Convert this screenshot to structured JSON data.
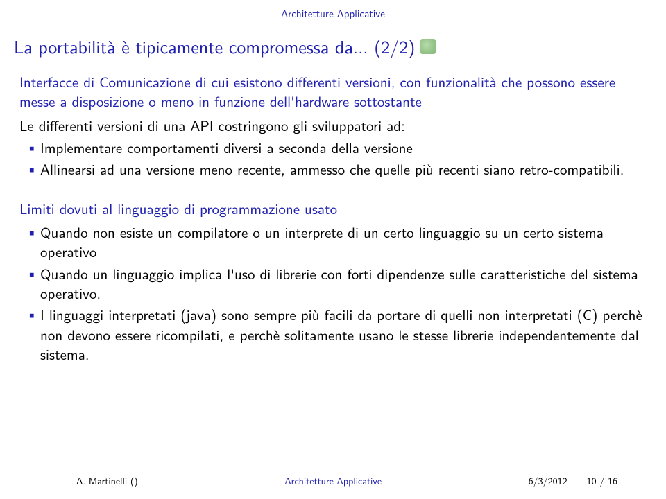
{
  "header": {
    "section": "Architetture Applicative"
  },
  "title": "La portabilità è tipicamente compromessa da... (2/2)",
  "block1": {
    "heading": "Interfacce di Comunicazione di cui esistono differenti versioni, con funzionalità che possono essere messe a disposizione o meno in funzione dell'hardware sottostante",
    "intro": "Le differenti versioni di una API costringono gli sviluppatori ad:",
    "items": [
      "Implementare comportamenti diversi a seconda della versione",
      "Allinearsi ad una versione meno recente, ammesso che quelle più recenti siano retro-compatibili."
    ]
  },
  "block2": {
    "heading": "Limiti dovuti al linguaggio di programmazione usato",
    "items": [
      "Quando non esiste un compilatore o un interprete di un certo linguaggio su un certo sistema operativo",
      "Quando un linguaggio implica l'uso di librerie con forti dipendenze sulle caratteristiche del sistema operativo.",
      "I linguaggi interpretati (java) sono sempre più facili da portare di quelli non interpretati (C) perchè non devono essere ricompilati, e perchè solitamente usano le stesse librerie independentemente dal sistema."
    ]
  },
  "footer": {
    "author": "A. Martinelli ()",
    "center": "Architetture Applicative",
    "date": "6/3/2012",
    "page": "10 / 16"
  }
}
